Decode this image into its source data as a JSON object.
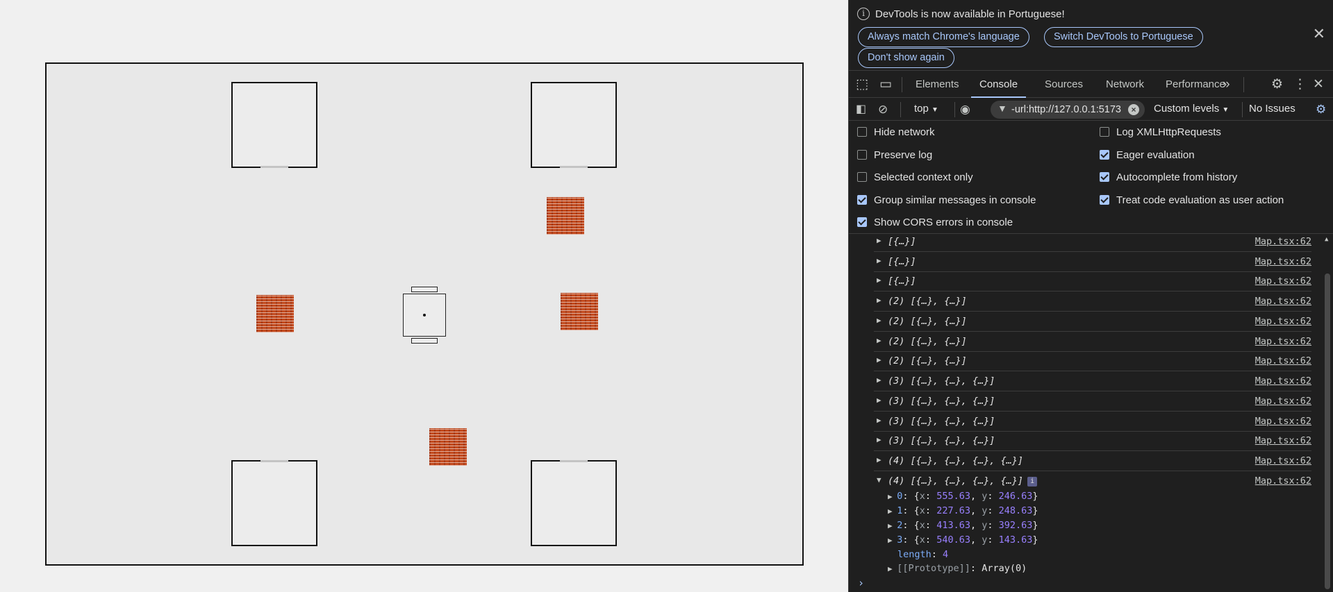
{
  "game": {
    "rooms": [
      {
        "id": "room-top-left",
        "door": "bottom"
      },
      {
        "id": "room-top-right",
        "door": "bottom"
      },
      {
        "id": "room-bottom-left",
        "door": "top"
      },
      {
        "id": "room-bottom-right",
        "door": "top"
      }
    ],
    "crate_color": "#c24a1e",
    "crate_count": 4
  },
  "devtools": {
    "infobar": {
      "message": "DevTools is now available in Portuguese!",
      "btn_match": "Always match Chrome's language",
      "btn_switch": "Switch DevTools to Portuguese",
      "btn_dont": "Don't show again",
      "close": "✕"
    },
    "tabs": [
      "Elements",
      "Console",
      "Sources",
      "Network",
      "Performance"
    ],
    "active_tab": "Console",
    "more": "»",
    "toolbar": {
      "context": "top",
      "filter_value": "-url:http://127.0.0.1:5173",
      "levels": "Custom levels",
      "issues": "No Issues"
    },
    "settings": {
      "left": [
        {
          "label": "Hide network",
          "checked": false
        },
        {
          "label": "Preserve log",
          "checked": false
        },
        {
          "label": "Selected context only",
          "checked": false
        },
        {
          "label": "Group similar messages in console",
          "checked": true
        },
        {
          "label": "Show CORS errors in console",
          "checked": true
        }
      ],
      "right": [
        {
          "label": "Log XMLHttpRequests",
          "checked": false
        },
        {
          "label": "Eager evaluation",
          "checked": true
        },
        {
          "label": "Autocomplete from history",
          "checked": true
        },
        {
          "label": "Treat code evaluation as user action",
          "checked": true
        }
      ]
    },
    "console": {
      "source": "Map.tsx:62",
      "rows": [
        "[{…}]",
        "[{…}]",
        "[{…}]",
        "(2) [{…}, {…}]",
        "(2) [{…}, {…}]",
        "(2) [{…}, {…}]",
        "(2) [{…}, {…}]",
        "(3) [{…}, {…}, {…}]",
        "(3) [{…}, {…}, {…}]",
        "(3) [{…}, {…}, {…}]",
        "(3) [{…}, {…}, {…}]",
        "(4) [{…}, {…}, {…}, {…}]"
      ],
      "expanded": {
        "text": "(4) [{…}, {…}, {…}, {…}]",
        "badge": "i",
        "items": [
          {
            "index": "0",
            "x": "555.63",
            "y": "246.63"
          },
          {
            "index": "1",
            "x": "227.63",
            "y": "248.63"
          },
          {
            "index": "2",
            "x": "413.63",
            "y": "392.63"
          },
          {
            "index": "3",
            "x": "540.63",
            "y": "143.63"
          }
        ],
        "length_key": "length",
        "length_value": "4",
        "prototype_key": "[[Prototype]]",
        "prototype_value": "Array(0)"
      },
      "prompt": "›"
    }
  }
}
